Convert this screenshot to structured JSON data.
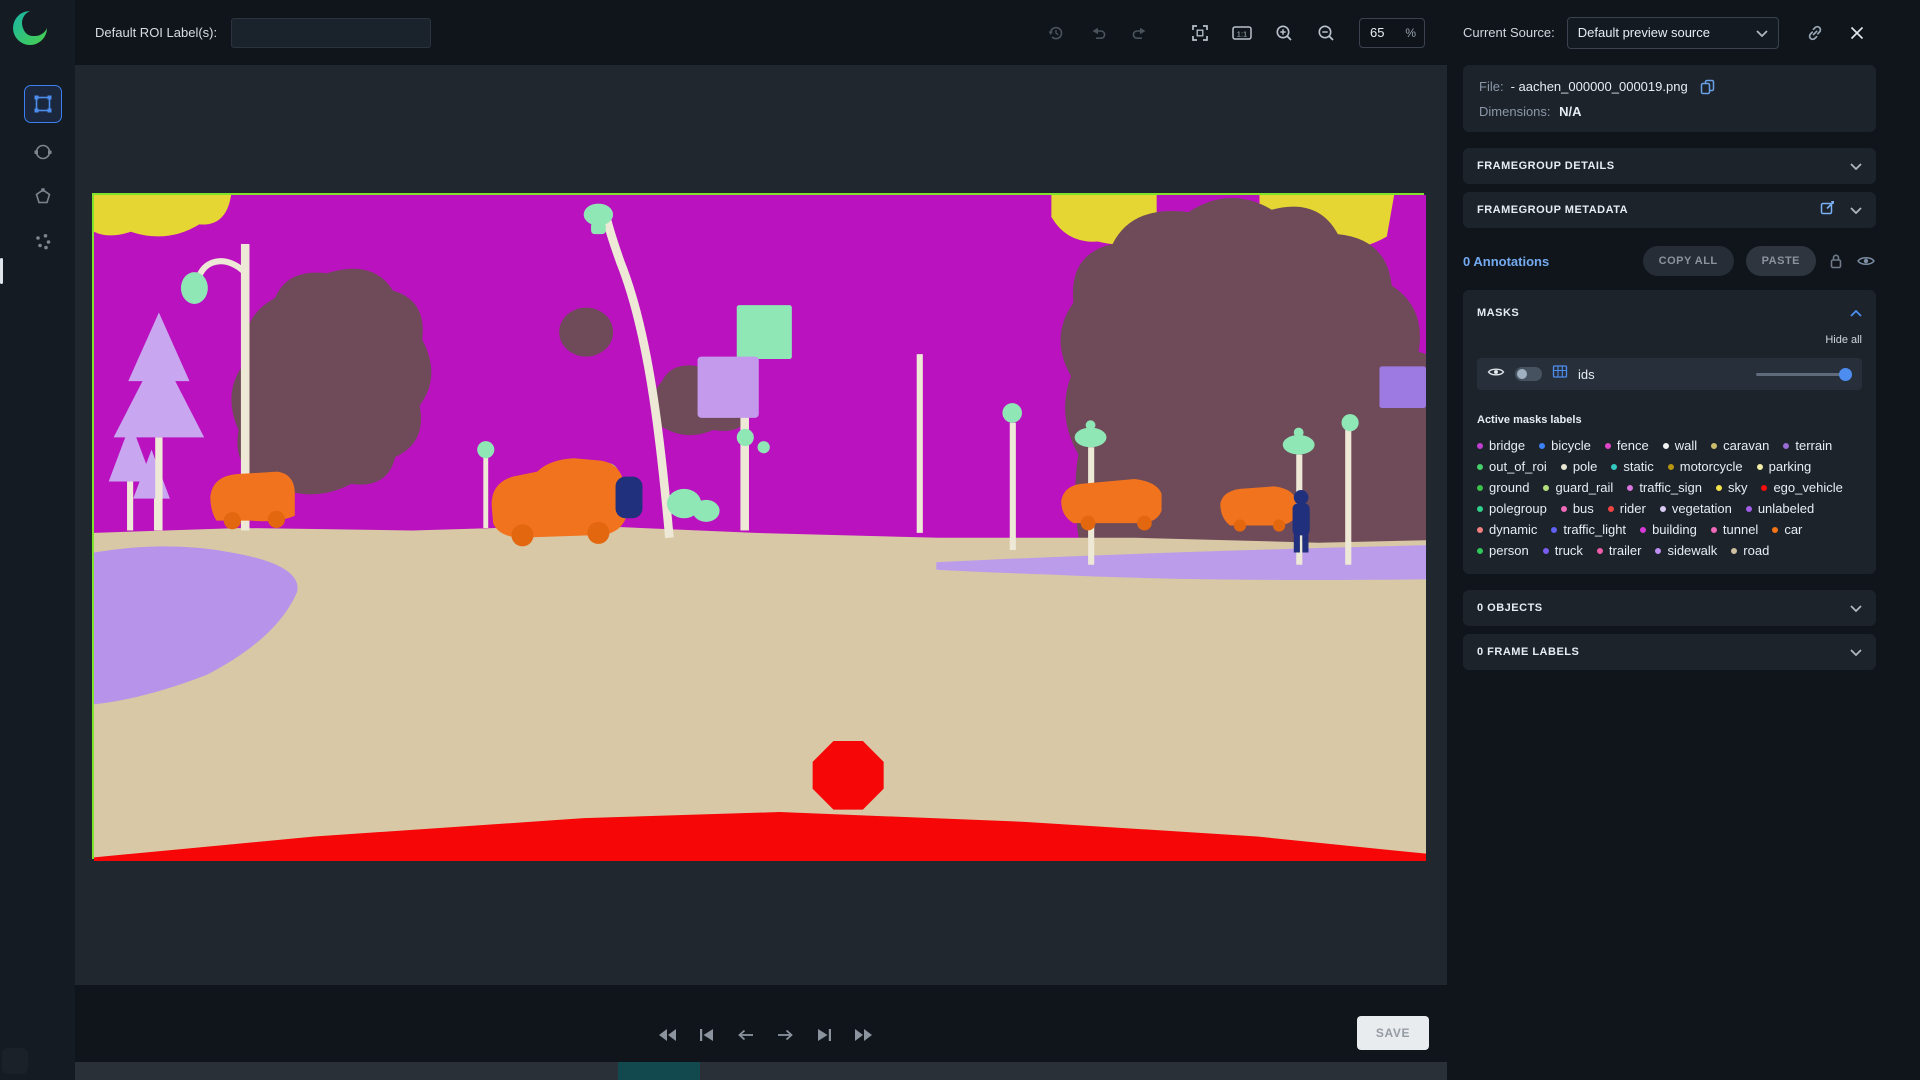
{
  "topbar": {
    "roi_label": "Default ROI Label(s):",
    "roi_input_value": "",
    "zoom_value": "65",
    "zoom_unit": "%",
    "one_to_one": "1:1"
  },
  "source_bar": {
    "label": "Current Source:",
    "value": "Default preview source"
  },
  "file_info": {
    "file_label": "File:",
    "file_name": "- aachen_000000_000019.png",
    "dimensions_label": "Dimensions:",
    "dimensions_value": "N/A"
  },
  "panels": {
    "framegroup_details": "FRAMEGROUP DETAILS",
    "framegroup_metadata": "FRAMEGROUP METADATA",
    "objects": "0 OBJECTS",
    "frame_labels": "0 FRAME LABELS"
  },
  "annotations": {
    "count_label": "0 Annotations",
    "copy_all": "COPY ALL",
    "paste": "PASTE"
  },
  "masks": {
    "title": "MASKS",
    "hide_all": "Hide all",
    "ids_label": "ids",
    "active_labels_title": "Active masks labels",
    "labels": [
      {
        "name": "bridge",
        "color": "#c13ed1"
      },
      {
        "name": "bicycle",
        "color": "#3b82f6"
      },
      {
        "name": "fence",
        "color": "#e045c8"
      },
      {
        "name": "wall",
        "color": "#f2f2f2"
      },
      {
        "name": "caravan",
        "color": "#cdbb6d"
      },
      {
        "name": "terrain",
        "color": "#9a6bd4"
      },
      {
        "name": "out_of_roi",
        "color": "#45d06a"
      },
      {
        "name": "pole",
        "color": "#e9e6d4"
      },
      {
        "name": "static",
        "color": "#35c8c0"
      },
      {
        "name": "motorcycle",
        "color": "#b8940f"
      },
      {
        "name": "parking",
        "color": "#f3eda6"
      },
      {
        "name": "ground",
        "color": "#3dbf4e"
      },
      {
        "name": "guard_rail",
        "color": "#b5e07f"
      },
      {
        "name": "traffic_sign",
        "color": "#d875de"
      },
      {
        "name": "sky",
        "color": "#f2e34a"
      },
      {
        "name": "ego_vehicle",
        "color": "#f60d0d"
      },
      {
        "name": "polegroup",
        "color": "#2fd08c"
      },
      {
        "name": "bus",
        "color": "#ef6ab8"
      },
      {
        "name": "rider",
        "color": "#ef4444"
      },
      {
        "name": "vegetation",
        "color": "#d9cbf2"
      },
      {
        "name": "unlabeled",
        "color": "#a15de8"
      },
      {
        "name": "dynamic",
        "color": "#f08080"
      },
      {
        "name": "traffic_light",
        "color": "#5f5ff0"
      },
      {
        "name": "building",
        "color": "#d63ad6"
      },
      {
        "name": "tunnel",
        "color": "#ef6ab8"
      },
      {
        "name": "car",
        "color": "#f57416"
      },
      {
        "name": "person",
        "color": "#2fc757"
      },
      {
        "name": "truck",
        "color": "#7a5cf0"
      },
      {
        "name": "trailer",
        "color": "#ef5da8"
      },
      {
        "name": "sidewalk",
        "color": "#bd8ef0"
      },
      {
        "name": "road",
        "color": "#cfc0a0"
      }
    ]
  },
  "footer": {
    "save": "SAVE"
  }
}
